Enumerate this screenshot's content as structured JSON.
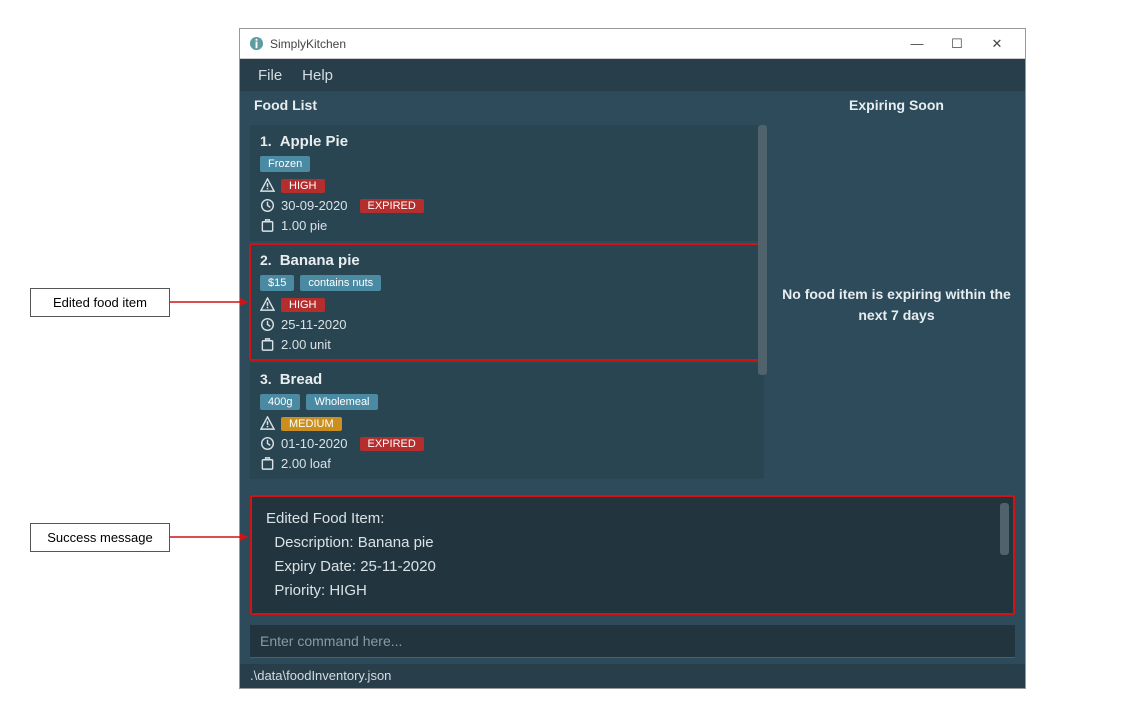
{
  "window": {
    "title": "SimplyKitchen",
    "min": "—",
    "max": "☐",
    "close": "✕"
  },
  "menubar": {
    "file": "File",
    "help": "Help"
  },
  "headers": {
    "food_list": "Food List",
    "expiring_soon": "Expiring Soon"
  },
  "food_items": [
    {
      "index": "1.",
      "name": "Apple Pie",
      "tags": [
        "Frozen"
      ],
      "priority": "HIGH",
      "priority_level": "high",
      "date": "30-09-2020",
      "expired": "EXPIRED",
      "qty": "1.00 pie"
    },
    {
      "index": "2.",
      "name": "Banana pie",
      "tags": [
        "$15",
        "contains nuts"
      ],
      "priority": "HIGH",
      "priority_level": "high",
      "date": "25-11-2020",
      "expired": null,
      "qty": "2.00 unit",
      "highlighted": true
    },
    {
      "index": "3.",
      "name": "Bread",
      "tags": [
        "400g",
        "Wholemeal"
      ],
      "priority": "MEDIUM",
      "priority_level": "medium",
      "date": "01-10-2020",
      "expired": "EXPIRED",
      "qty": "2.00 loaf"
    }
  ],
  "expiring": {
    "message": "No food item is expiring within the next 7 days"
  },
  "result": {
    "line1": "Edited Food Item:",
    "line2": "  Description: Banana pie",
    "line3": "  Expiry Date: 25-11-2020",
    "line4": "  Priority: HIGH"
  },
  "command": {
    "placeholder": "Enter command here..."
  },
  "statusbar": {
    "path": ".\\data\\foodInventory.json"
  },
  "callouts": {
    "edited": "Edited food item",
    "success": "Success message"
  }
}
